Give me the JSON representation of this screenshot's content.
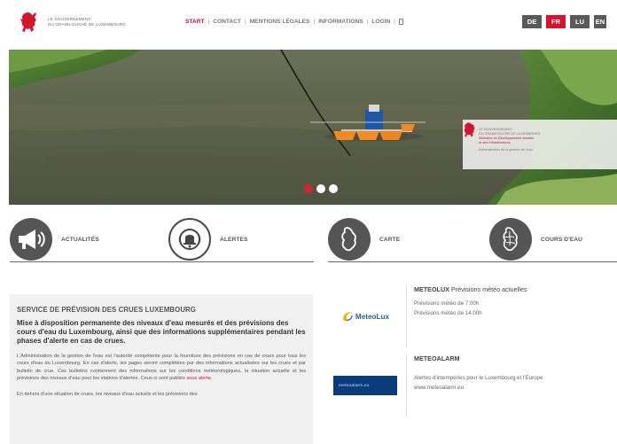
{
  "header": {
    "gov_line1": "LE GOUVERNEMENT",
    "gov_line2": "DU GRAND-DUCHÉ DE LUXEMBOURG",
    "nav": [
      {
        "label": "START",
        "active": true
      },
      {
        "label": "CONTACT",
        "active": false
      },
      {
        "label": "MENTIONS LÉGALES",
        "active": false
      },
      {
        "label": "INFORMATIONS",
        "active": false
      },
      {
        "label": "LOGIN",
        "active": false
      }
    ],
    "languages": [
      "DE",
      "FR",
      "LU",
      "EN"
    ],
    "active_language": "FR"
  },
  "hero": {
    "card_line1": "LE GOUVERNEMENT",
    "card_line2": "DU GRAND-DUCHÉ DE LUXEMBOURG",
    "card_line3": "Ministère du Développement durable",
    "card_line4": "et des Infrastructures",
    "card_line5": "Administration de la gestion de l'eau",
    "slides": 3,
    "active_slide": 1
  },
  "tiles": [
    {
      "label": "ACTUALITÉS",
      "icon": "megaphone-icon"
    },
    {
      "label": "ALERTES",
      "icon": "alarm-bell-icon"
    },
    {
      "label": "CARTE",
      "icon": "luxembourg-map-icon"
    },
    {
      "label": "COURS D'EAU",
      "icon": "river-map-icon"
    }
  ],
  "main": {
    "section_title": "SERVICE DE PRÉVISION DES CRUES LUXEMBOURG",
    "lead": "Mise à disposition permanente des niveaux d'eau mesurés et des prévisions des cours d'eau du Luxembourg, ainsi que des informations supplémentaires pendant les phases d'alerte en cas de crues.",
    "paragraph1_part1": "L'Administration de la gestion de l'eau est l'autorité compétente pour la fourniture des prévisions en cas de crues pour tous les cours d'eau du Luxembourg. En cas d'alerte, les pages seront complétées par des informations actualisées sur les crues et par bulletin de crue. Ces bulletins contiennent des informations sur les conditions météorologiques, la situation actuelle et les prévisions des niveaux d'eau pour les stations d'alertes. Ceux-ci sont publiés ",
    "paragraph1_link": "sous alerte",
    "paragraph1_part2": ".",
    "paragraph2": "En dehors d'une situation de crues, les niveaux d'eau actuels et les prévisions des"
  },
  "widgets": {
    "meteolux": {
      "logo_text": "MeteoLux",
      "title_bold": "METEOLUX",
      "title_rest": " Prévisions météo actuelles",
      "line1": "Prévisions météo de 7:00h",
      "line2": "Prévisions météo de 14:00h"
    },
    "meteoalarm": {
      "logo_text": "meteoalarm.eu",
      "title": "METEOALARM",
      "line1": "Alertes d'intempéries pour le Luxembourg et l'Europe",
      "line2": "www.meteoalarm.eu"
    }
  },
  "colors": {
    "accent": "#d5152b",
    "nav_gray": "#777777",
    "lang_bg": "#5a5a5a",
    "meteolux_blue": "#2c5e9e",
    "meteoalarm_bg": "#0a3c7c"
  }
}
